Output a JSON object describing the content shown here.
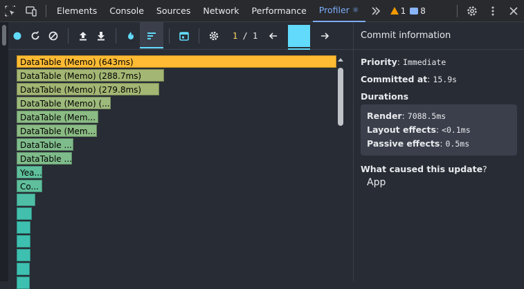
{
  "devtools": {
    "tabs": [
      {
        "label": "Elements"
      },
      {
        "label": "Console"
      },
      {
        "label": "Sources"
      },
      {
        "label": "Network"
      },
      {
        "label": "Performance"
      },
      {
        "label": "Profiler"
      }
    ],
    "active_tab": "Profiler",
    "warnings_count": "1",
    "messages_count": "8"
  },
  "profiler": {
    "commit_current": "1",
    "commit_separator": "/",
    "commit_total": "1",
    "flame_bars": [
      {
        "label": "DataTable (Memo) (643ms)",
        "color": "#ffbb33"
      },
      {
        "label": "DataTable (Memo) (288.7ms)",
        "color": "#a3b673"
      },
      {
        "label": "DataTable (Memo) (279.8ms)",
        "color": "#a3b673"
      },
      {
        "label": "DataTable (Memo) (...",
        "color": "#9dba7c"
      },
      {
        "label": "DataTable (Mem...",
        "color": "#8bbb84"
      },
      {
        "label": "DataTable (Mem...",
        "color": "#8bbb84"
      },
      {
        "label": "DataTable ...",
        "color": "#7fbc8b"
      },
      {
        "label": "DataTable ...",
        "color": "#7fbc8b"
      },
      {
        "label": "Yea...",
        "color": "#5fbf9c"
      },
      {
        "label": "Co...",
        "color": "#5fbf9c"
      },
      {
        "label": "",
        "color": "#4ebfa6"
      },
      {
        "label": "",
        "color": "#43c0ad"
      },
      {
        "label": "",
        "color": "#3ec0b0"
      },
      {
        "label": "",
        "color": "#3ec0b0"
      },
      {
        "label": "",
        "color": "#3ec0b0"
      },
      {
        "label": "",
        "color": "#3ec0b0"
      },
      {
        "label": "",
        "color": "#3ec0b0"
      }
    ]
  },
  "commit_info": {
    "title": "Commit information",
    "priority_label": "Priority",
    "priority_value": "Immediate",
    "committed_at_label": "Committed at",
    "committed_at_value": "15.9s",
    "durations_label": "Durations",
    "render_label": "Render",
    "render_value": "7088.5ms",
    "layout_label": "Layout effects",
    "layout_value": "<0.1ms",
    "passive_label": "Passive effects",
    "passive_value": "0.5ms",
    "cause_label": "What caused this update",
    "cause_items": [
      "App"
    ]
  }
}
